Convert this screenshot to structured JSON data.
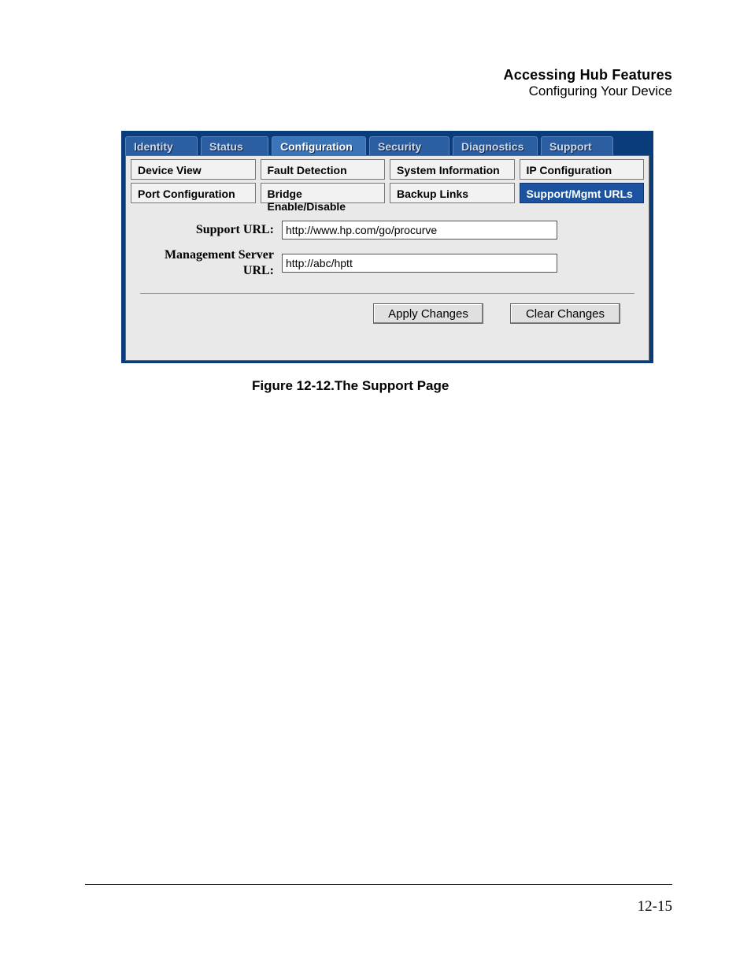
{
  "header": {
    "title": "Accessing Hub Features",
    "subtitle": "Configuring Your Device"
  },
  "top_tabs": {
    "identity": "Identity",
    "status": "Status",
    "configuration": "Configuration",
    "security": "Security",
    "diagnostics": "Diagnostics",
    "support": "Support"
  },
  "sub_tabs": {
    "row1": {
      "device_view": "Device View",
      "fault_detection": "Fault Detection",
      "system_information": "System Information",
      "ip_configuration": "IP Configuration"
    },
    "row2": {
      "port_configuration": "Port Configuration",
      "bridge_enable_disable": "Bridge Enable/Disable",
      "backup_links": "Backup Links",
      "support_mgmt_urls": "Support/Mgmt URLs"
    }
  },
  "form": {
    "support_url_label": "Support URL:",
    "support_url_value": "http://www.hp.com/go/procurve",
    "mgmt_server_url_label": "Management Server URL:",
    "mgmt_server_url_value": "http://abc/hptt"
  },
  "buttons": {
    "apply": "Apply Changes",
    "clear": "Clear Changes"
  },
  "caption": "Figure 12-12.The Support Page",
  "page_number": "12-15"
}
